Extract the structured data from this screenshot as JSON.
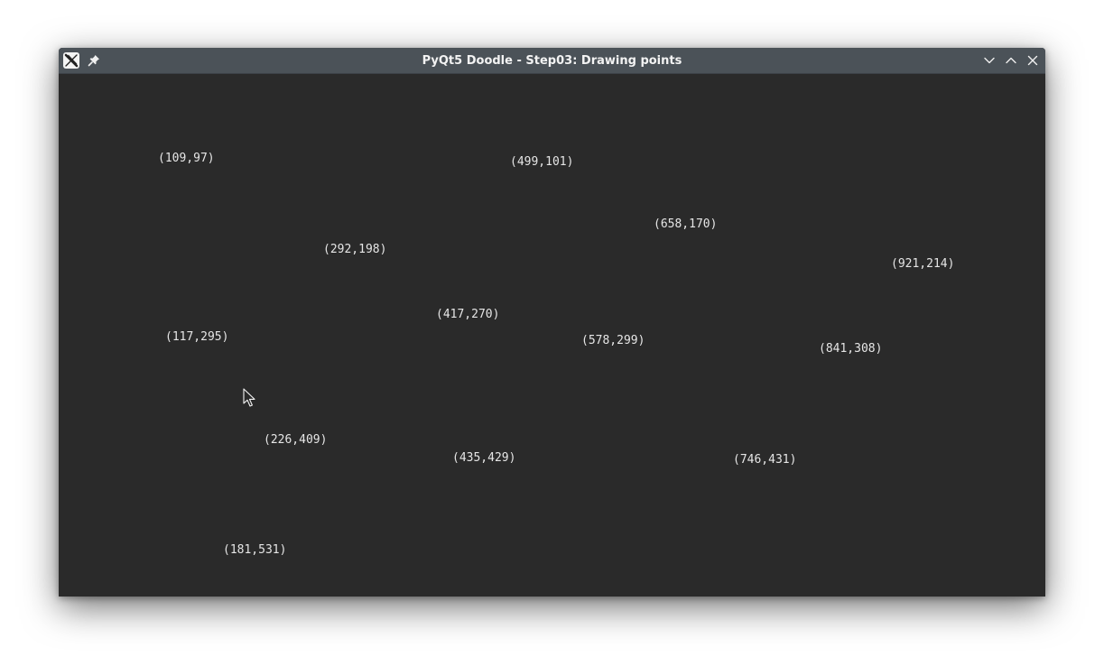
{
  "window": {
    "title": "PyQt5 Doodle - Step03: Drawing points"
  },
  "icons": {
    "app": "x11-app-icon",
    "pin": "pin-icon",
    "minimize": "chevron-down-icon",
    "maximize": "chevron-up-icon",
    "close": "close-icon",
    "cursor": "mouse-cursor-icon"
  },
  "colors": {
    "titlebar": "#4b5258",
    "canvas": "#2a2a2a",
    "label_text": "#e6e6e6"
  },
  "points": [
    {
      "label": "(109,97)"
    },
    {
      "label": "(499,101)"
    },
    {
      "label": "(658,170)"
    },
    {
      "label": "(292,198)"
    },
    {
      "label": "(921,214)"
    },
    {
      "label": "(417,270)"
    },
    {
      "label": "(117,295)"
    },
    {
      "label": "(578,299)"
    },
    {
      "label": "(841,308)"
    },
    {
      "label": "(226,409)"
    },
    {
      "label": "(435,429)"
    },
    {
      "label": "(746,431)"
    },
    {
      "label": "(181,531)"
    }
  ]
}
